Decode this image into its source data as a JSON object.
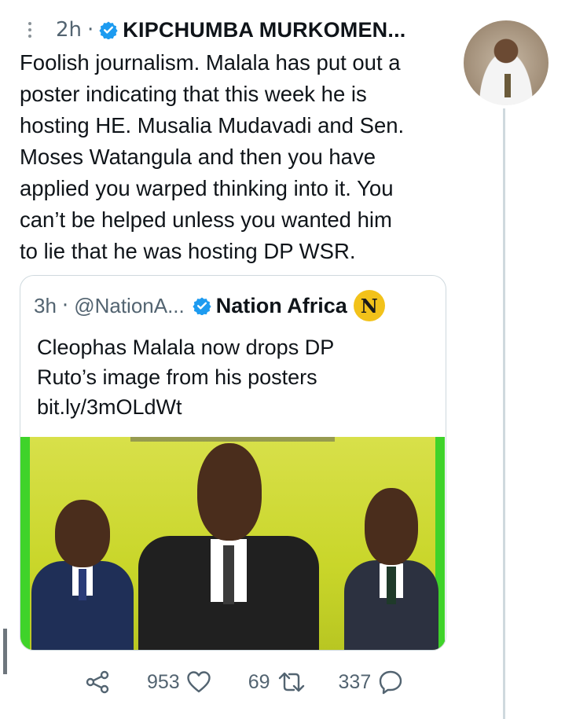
{
  "tweet": {
    "time": "2h",
    "separator": "·",
    "author": "KIPCHUMBA MURKOMEN...",
    "lines": [
      "Foolish journalism. Malala has put out a",
      "poster indicating that this week he is",
      "hosting HE. Musalia Mudavadi and Sen.",
      "Moses Watangula and then you have",
      "applied you warped thinking into it. You",
      "can’t be helped unless you wanted him",
      "to lie that he was hosting DP WSR."
    ]
  },
  "quote": {
    "time": "3h",
    "separator": "·",
    "handle": "@NationA...",
    "author": "Nation Africa",
    "logo_letter": "N",
    "lines": [
      "Cleophas Malala now drops DP",
      "Ruto’s image from his posters",
      "bit.ly/3mOLdWt"
    ]
  },
  "actions": {
    "share_icon": "share-icon",
    "likes": "953",
    "like_icon": "heart-icon",
    "retweets": "69",
    "retweet_icon": "retweet-icon",
    "replies": "337",
    "reply_icon": "reply-icon"
  },
  "colors": {
    "verified": "#1d9bf0",
    "muted_text": "#536471",
    "border": "#cfd9de",
    "poster_background": "#d3dc3a",
    "poster_border": "#3fd32a",
    "nation_logo": "#f2c21a"
  }
}
